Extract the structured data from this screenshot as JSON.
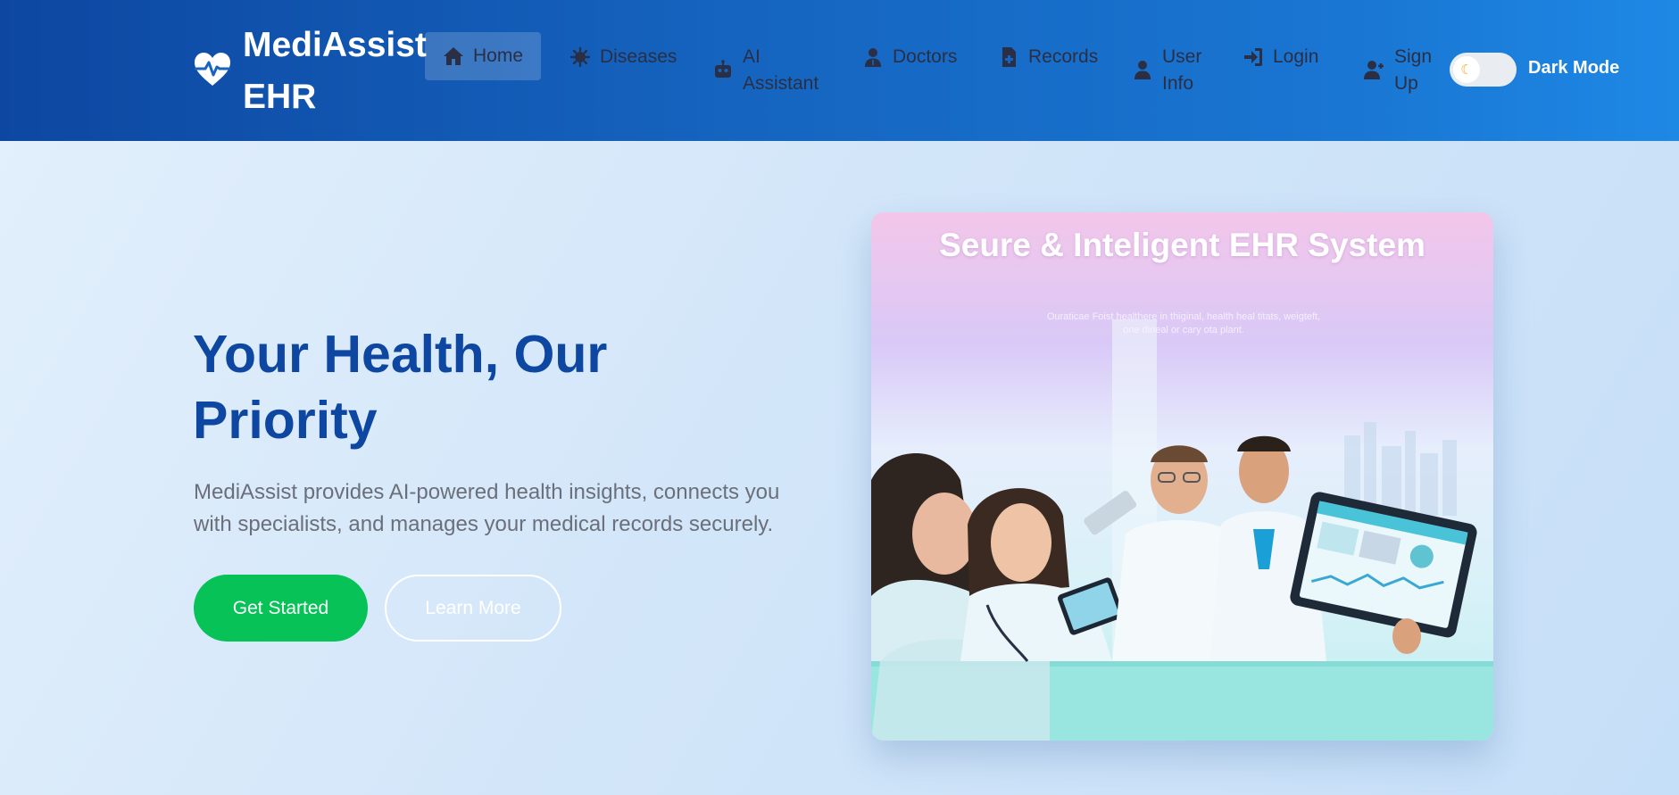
{
  "brand": {
    "name": "MediAssist EHR",
    "icon": "heart-pulse-icon"
  },
  "nav": {
    "items": [
      {
        "label": "Home",
        "icon": "home-icon",
        "active": true
      },
      {
        "label": "Diseases",
        "icon": "virus-icon",
        "active": false
      },
      {
        "label": "AI Assistant",
        "icon": "robot-icon",
        "active": false
      },
      {
        "label": "Doctors",
        "icon": "doctor-icon",
        "active": false
      },
      {
        "label": "Records",
        "icon": "file-medical-icon",
        "active": false
      },
      {
        "label": "User Info",
        "icon": "user-icon",
        "active": false
      },
      {
        "label": "Login",
        "icon": "sign-in-icon",
        "active": false
      },
      {
        "label": "Sign Up",
        "icon": "user-plus-icon",
        "active": false
      }
    ],
    "dark_mode_label": "Dark Mode",
    "dark_mode_on": false,
    "toggle_icon": "moon-icon"
  },
  "hero": {
    "title": "Your Health, Our Priority",
    "description": "MediAssist provides AI-powered health insights, connects you with specialists, and manages your medical records securely.",
    "primary_button": "Get Started",
    "secondary_button": "Learn More"
  },
  "hero_image": {
    "title": "Seure & Inteligent EHR System",
    "subtitle": "Ouraticae Foist healthere in thiginal, health heal titats, weigteft, one dineal or cary ota plant."
  },
  "colors": {
    "header_start": "#0d47a1",
    "header_end": "#1e88e5",
    "title": "#0d47a1",
    "primary_button": "#06c257",
    "body_text": "#6b6f7a"
  }
}
